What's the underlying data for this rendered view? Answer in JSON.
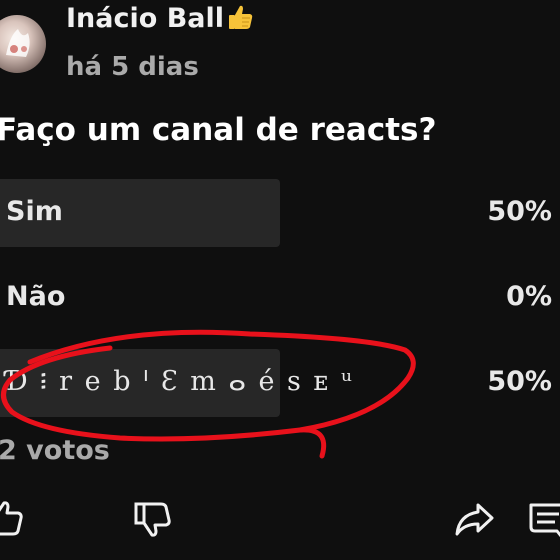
{
  "post": {
    "author": "Inácio Ball",
    "author_emoji": "thumbs-up-emoji",
    "time": "há 5 dias",
    "question": "Faço um canal de reacts?"
  },
  "poll": {
    "options": [
      {
        "label": "Sim",
        "percent": "50%",
        "fill": 0.5
      },
      {
        "label": "Não",
        "percent": "0%",
        "fill": 0.0
      },
      {
        "label": "Ɗ ፧ r e b ᑊ Ɛ m ⴰ é s ᴇ ᵘ",
        "percent": "50%",
        "fill": 0.5
      }
    ],
    "votes": "2 votos"
  },
  "colors": {
    "background": "#0f0f0f",
    "bar": "#272727",
    "scribble": "#e8111b",
    "secondary_text": "#aaaaaa"
  },
  "actions": [
    "like-icon",
    "dislike-icon",
    "share-icon",
    "comment-icon"
  ]
}
